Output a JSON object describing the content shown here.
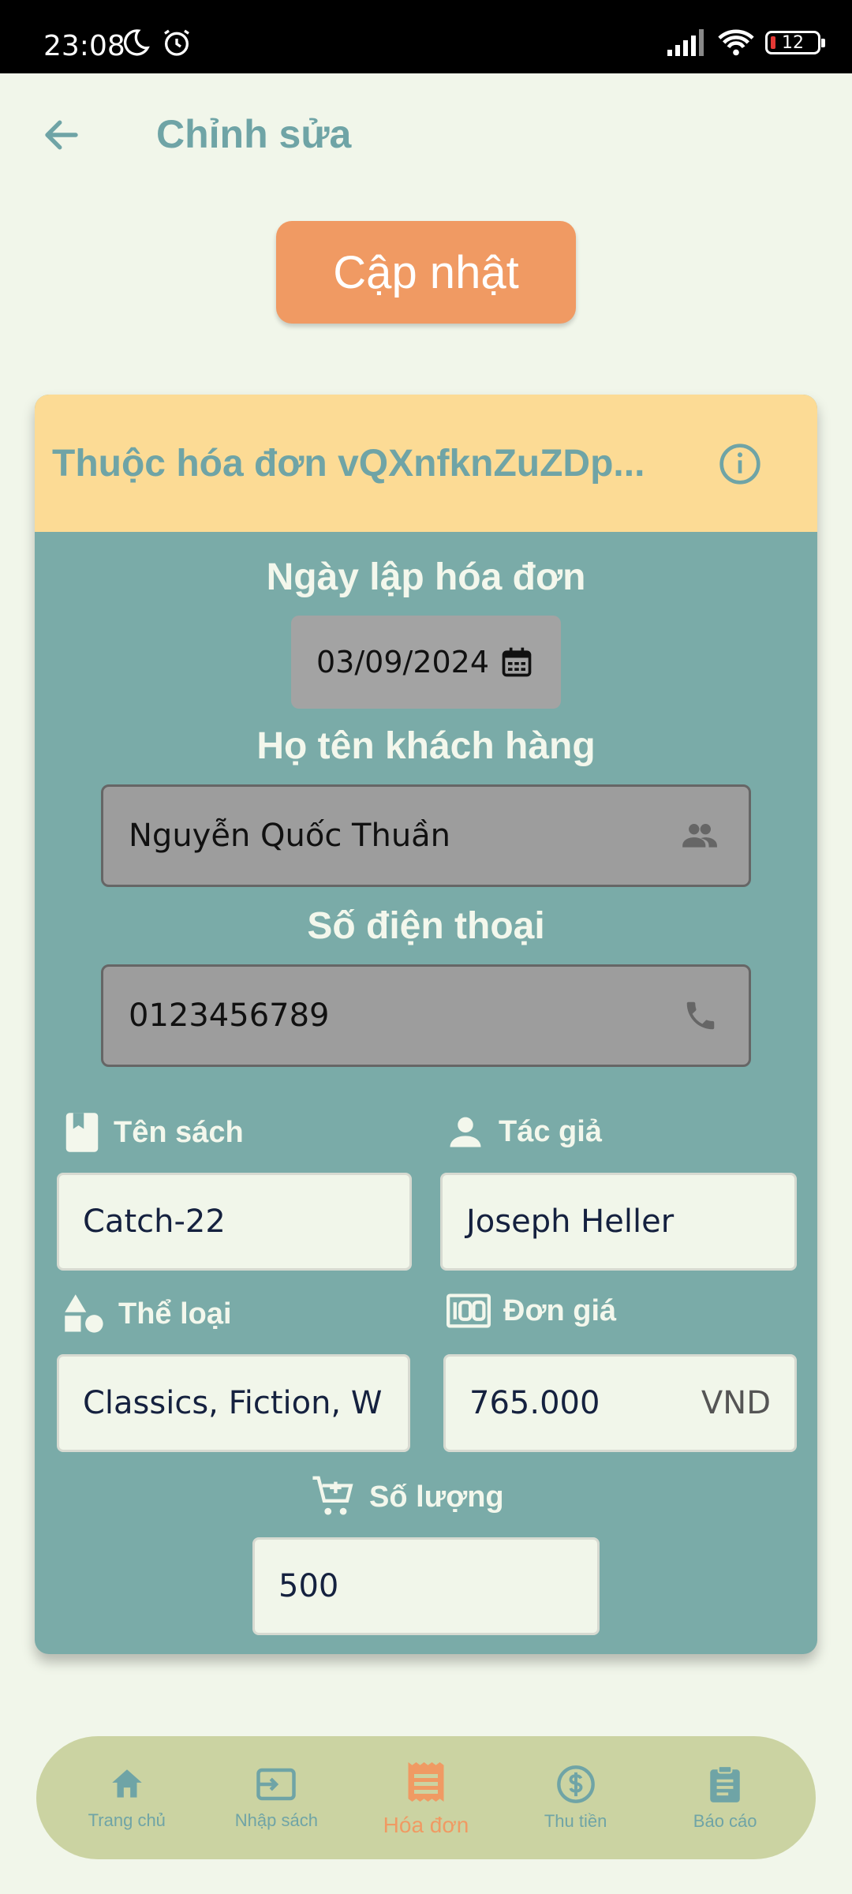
{
  "status_bar": {
    "time": "23:08",
    "battery": "12"
  },
  "appbar": {
    "title": "Chỉnh sửa"
  },
  "update_button": {
    "label": "Cập nhật"
  },
  "card": {
    "header_title": "Thuộc hóa đơn vQXnfknZuZDp...",
    "invoice_date": {
      "label": "Ngày lập hóa đơn",
      "value": "03/09/2024"
    },
    "customer_name": {
      "label": "Họ tên khách hàng",
      "value": "Nguyễn Quốc Thuần"
    },
    "phone": {
      "label": "Số điện thoại",
      "value": "0123456789"
    },
    "book_title": {
      "label": "Tên sách",
      "value": "Catch-22"
    },
    "author": {
      "label": "Tác giả",
      "value": "Joseph Heller"
    },
    "genre": {
      "label": "Thể loại",
      "value": "Classics, Fiction, W"
    },
    "unit_price": {
      "label": "Đơn giá",
      "value": "765.000",
      "suffix": "VND"
    },
    "quantity": {
      "label": "Số lượng",
      "value": "500"
    }
  },
  "nav": {
    "home": "Trang chủ",
    "import": "Nhập sách",
    "invoice": "Hóa đơn",
    "collect": "Thu tiền",
    "report": "Báo cáo"
  },
  "colors": {
    "accent": "#f09a63",
    "teal": "#6fa4a6",
    "card": "#7aaba8",
    "header": "#fcdb95",
    "nav": "#cbd3a2"
  }
}
